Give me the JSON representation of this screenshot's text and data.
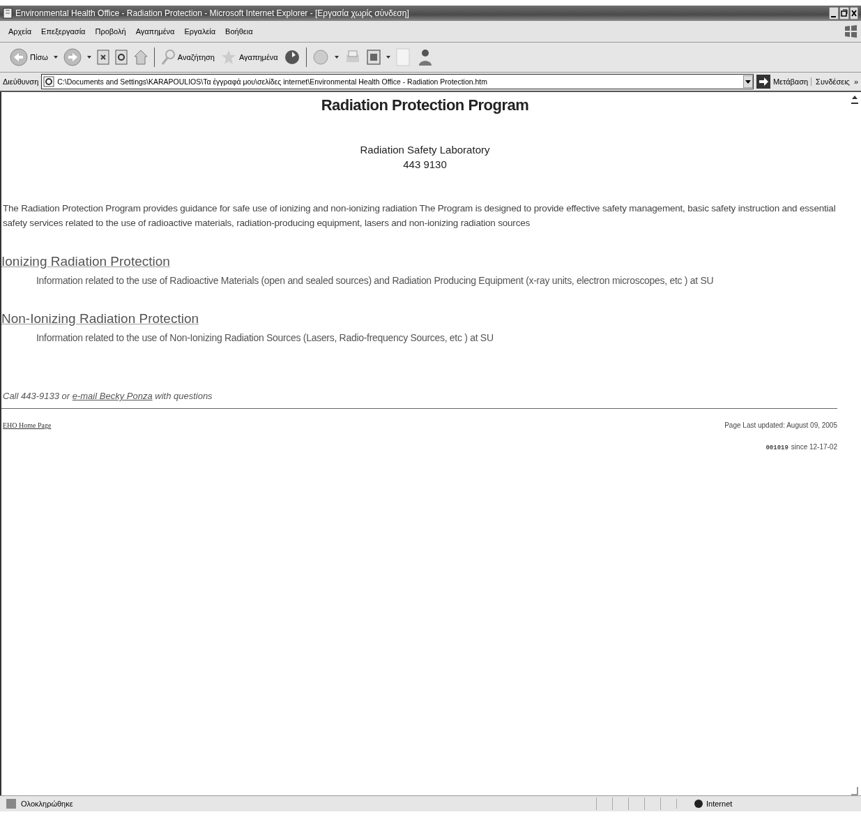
{
  "window": {
    "title": "Environmental Health Office - Radiation Protection - Microsoft Internet Explorer - [Εργασία χωρίς σύνδεση]"
  },
  "menu": [
    "Αρχεία",
    "Επεξεργασία",
    "Προβολή",
    "Αγαπημένα",
    "Εργαλεία",
    "Βοήθεια"
  ],
  "toolbar": {
    "back": "Πίσω",
    "search": "Αναζήτηση",
    "favorites": "Αγαπημένα"
  },
  "address": {
    "label": "Διεύθυνση",
    "value": "C:\\Documents and Settings\\KARAPOULIOS\\Τα έγγραφά μου\\σελίδες internet\\Environmental Health Office - Radiation Protection.htm",
    "go": "Μετάβαση",
    "links": "Συνδέσεις",
    "more": "»"
  },
  "page": {
    "heading": "Radiation Protection Program",
    "lab": "Radiation Safety Laboratory",
    "phone": "443 9130",
    "intro": "The Radiation Protection Program provides guidance for safe use of ionizing and non-ionizing radiation  The Program is designed to provide effective safety management, basic safety instruction and essential safety services related to the use of radioactive materials, radiation-producing equipment, lasers and non-ionizing radiation sources",
    "sections": [
      {
        "title": "Ionizing Radiation Protection",
        "text": "Information related to the use of Radioactive Materials (open and sealed sources) and Radiation Producing Equipment (x-ray units, electron microscopes, etc ) at SU"
      },
      {
        "title": "Non-Ionizing Radiation Protection",
        "text": "Information related to the use of Non-Ionizing Radiation Sources (Lasers, Radio-frequency Sources, etc ) at SU"
      }
    ],
    "contact": {
      "before": "Call 443-9133 or ",
      "link": "e-mail Becky Ponza",
      "after": " with questions"
    },
    "home_link": "EHO Home Page",
    "updated": "Page Last updated: August 09, 2005",
    "counter": "001019",
    "since": "since 12-17-02"
  },
  "status": {
    "text": "Ολοκληρώθηκε",
    "zone": "Internet"
  }
}
